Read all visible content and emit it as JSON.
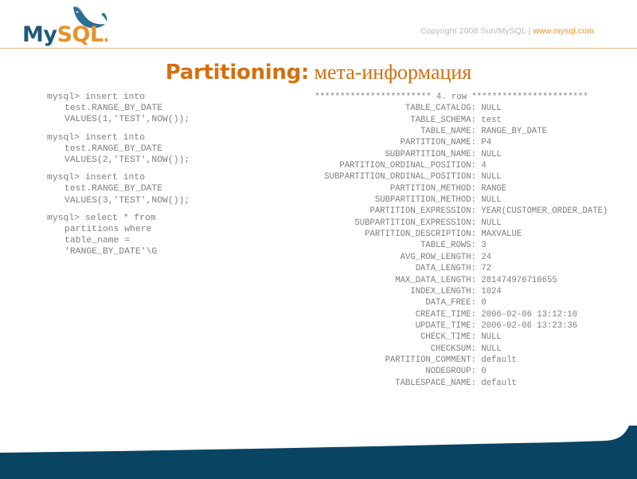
{
  "header": {
    "logo": {
      "wordmark_my": "My",
      "wordmark_sql": "SQL",
      "wordmark_dot": ".",
      "dolphin_icon": "dolphin-icon"
    },
    "copyright_prefix": "Copyright 2008 Sun/MySQL | ",
    "copyright_url": "www.mysql.com"
  },
  "title": {
    "main": "Partitioning:",
    "sub": " мета-информация"
  },
  "left_code": {
    "statements": [
      {
        "prompt": "mysql> insert into",
        "lines": [
          "test.RANGE_BY_DATE",
          "VALUES(1,'TEST',NOW());"
        ]
      },
      {
        "prompt": "mysql> insert into",
        "lines": [
          "test.RANGE_BY_DATE",
          "VALUES(2,'TEST',NOW());"
        ]
      },
      {
        "prompt": "mysql> insert into",
        "lines": [
          "test.RANGE_BY_DATE",
          "VALUES(3,'TEST',NOW());"
        ]
      },
      {
        "prompt": "mysql> select * from",
        "lines": [
          "partitions where",
          "table_name =",
          "'RANGE_BY_DATE'\\G"
        ]
      }
    ]
  },
  "right_code": {
    "row_separator": "*********************** 4. row ***********************",
    "fields": [
      {
        "name": "TABLE_CATALOG",
        "value": "NULL"
      },
      {
        "name": "TABLE_SCHEMA",
        "value": "test"
      },
      {
        "name": "TABLE_NAME",
        "value": "RANGE_BY_DATE"
      },
      {
        "name": "PARTITION_NAME",
        "value": "P4"
      },
      {
        "name": "SUBPARTITION_NAME",
        "value": "NULL"
      },
      {
        "name": "PARTITION_ORDINAL_POSITION",
        "value": "4"
      },
      {
        "name": "SUBPARTITION_ORDINAL_POSITION",
        "value": "NULL"
      },
      {
        "name": "PARTITION_METHOD",
        "value": "RANGE"
      },
      {
        "name": "SUBPARTITION_METHOD",
        "value": "NULL"
      },
      {
        "name": "PARTITION_EXPRESSION",
        "value": "YEAR(CUSTOMER_ORDER_DATE)"
      },
      {
        "name": "SUBPARTITION_EXPRESSION",
        "value": "NULL"
      },
      {
        "name": "PARTITION_DESCRIPTION",
        "value": "MAXVALUE"
      },
      {
        "name": "TABLE_ROWS",
        "value": "3"
      },
      {
        "name": "AVG_ROW_LENGTH",
        "value": "24"
      },
      {
        "name": "DATA_LENGTH",
        "value": "72"
      },
      {
        "name": "MAX_DATA_LENGTH",
        "value": "281474976710655"
      },
      {
        "name": "INDEX_LENGTH",
        "value": "1024"
      },
      {
        "name": "DATA_FREE",
        "value": "0"
      },
      {
        "name": "CREATE_TIME",
        "value": "2006-02-06 13:12:10"
      },
      {
        "name": "UPDATE_TIME",
        "value": "2006-02-06 13:23:36"
      },
      {
        "name": "CHECK_TIME",
        "value": "NULL"
      },
      {
        "name": "CHECKSUM",
        "value": "NULL"
      },
      {
        "name": "PARTITION_COMMENT",
        "value": "default"
      },
      {
        "name": "NODEGROUP",
        "value": "0"
      },
      {
        "name": "TABLESPACE_NAME",
        "value": "default"
      }
    ]
  },
  "colors": {
    "accent_orange": "#d4700f",
    "logo_blue": "#1f5a77",
    "logo_orange": "#e8912d",
    "footer_blue": "#0a4463",
    "rule_orange": "#e9b98a",
    "code_gray": "#7d7d7d"
  }
}
